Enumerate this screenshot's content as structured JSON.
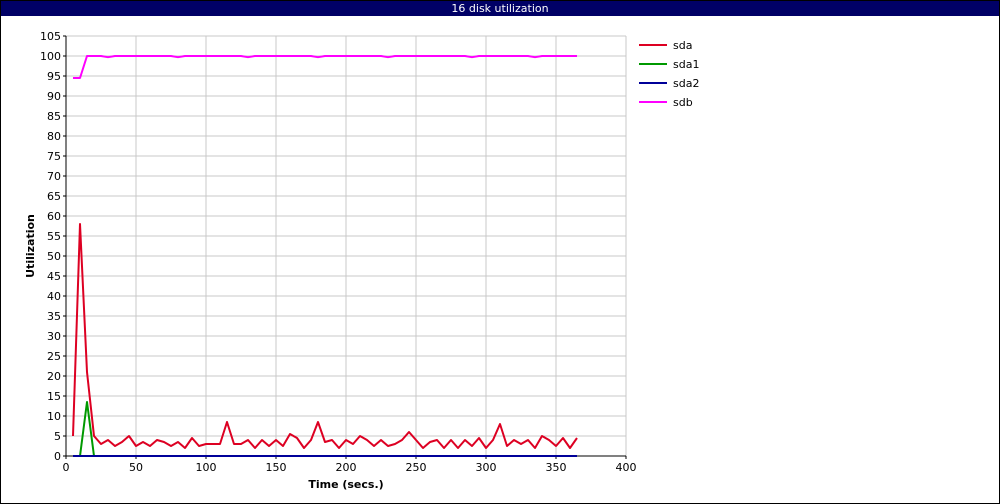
{
  "chart_data": {
    "type": "line",
    "title": "16 disk utilization",
    "xlabel": "Time (secs.)",
    "ylabel": "Utilization",
    "xlim": [
      0,
      400
    ],
    "ylim": [
      0,
      105
    ],
    "x_ticks": [
      0,
      50,
      100,
      150,
      200,
      250,
      300,
      350,
      400
    ],
    "y_ticks": [
      0,
      5,
      10,
      15,
      20,
      25,
      30,
      35,
      40,
      45,
      50,
      55,
      60,
      65,
      70,
      75,
      80,
      85,
      90,
      95,
      100,
      105
    ],
    "grid": true,
    "legend_position": "right",
    "series": [
      {
        "name": "sda",
        "color": "#dd0022",
        "x": [
          5,
          10,
          15,
          20,
          25,
          30,
          35,
          40,
          45,
          50,
          55,
          60,
          65,
          70,
          75,
          80,
          85,
          90,
          95,
          100,
          105,
          110,
          115,
          120,
          125,
          130,
          135,
          140,
          145,
          150,
          155,
          160,
          165,
          170,
          175,
          180,
          185,
          190,
          195,
          200,
          205,
          210,
          215,
          220,
          225,
          230,
          235,
          240,
          245,
          250,
          255,
          260,
          265,
          270,
          275,
          280,
          285,
          290,
          295,
          300,
          305,
          310,
          315,
          320,
          325,
          330,
          335,
          340,
          345,
          350,
          355,
          360,
          365
        ],
        "y": [
          5,
          58,
          21,
          5,
          3,
          4,
          2.5,
          3.5,
          5,
          2.5,
          3.5,
          2.5,
          4,
          3.5,
          2.5,
          3.5,
          2,
          4.5,
          2.5,
          3,
          3,
          3,
          8.5,
          3,
          3,
          4,
          2,
          4,
          2.5,
          4,
          2.5,
          5.5,
          4.5,
          2,
          4,
          8.5,
          3.5,
          4,
          2,
          4,
          3,
          5,
          4,
          2.5,
          4,
          2.5,
          3,
          4,
          6,
          4,
          2,
          3.5,
          4,
          2,
          4,
          2,
          4,
          2.5,
          4.5,
          2,
          4,
          8,
          2.5,
          4,
          3,
          4,
          2,
          5,
          4,
          2.5,
          4.5,
          2,
          4.5
        ]
      },
      {
        "name": "sda1",
        "color": "#009900",
        "x": [
          5,
          10,
          15,
          20,
          25,
          30,
          35,
          40,
          45,
          50,
          55,
          60,
          65,
          70,
          75,
          80,
          85,
          90,
          95,
          100,
          105,
          110,
          115,
          120,
          125,
          130,
          135,
          140,
          145,
          150,
          155,
          160,
          165,
          170,
          175,
          180,
          185,
          190,
          195,
          200,
          205,
          210,
          215,
          220,
          225,
          230,
          235,
          240,
          245,
          250,
          255,
          260,
          265,
          270,
          275,
          280,
          285,
          290,
          295,
          300,
          305,
          310,
          315,
          320,
          325,
          330,
          335,
          340,
          345,
          350,
          355,
          360,
          365
        ],
        "y": [
          0,
          0,
          13.5,
          0,
          0,
          0,
          0,
          0,
          0,
          0,
          0,
          0,
          0,
          0,
          0,
          0,
          0,
          0,
          0,
          0,
          0,
          0,
          0,
          0,
          0,
          0,
          0,
          0,
          0,
          0,
          0,
          0,
          0,
          0,
          0,
          0,
          0,
          0,
          0,
          0,
          0,
          0,
          0,
          0,
          0,
          0,
          0,
          0,
          0,
          0,
          0,
          0,
          0,
          0,
          0,
          0,
          0,
          0,
          0,
          0,
          0,
          0,
          0,
          0,
          0,
          0,
          0,
          0,
          0,
          0,
          0,
          0,
          0
        ]
      },
      {
        "name": "sda2",
        "color": "#000099",
        "x": [
          5,
          365
        ],
        "y": [
          0,
          0
        ]
      },
      {
        "name": "sdb",
        "color": "#ff00ff",
        "x": [
          5,
          10,
          15,
          20,
          25,
          30,
          35,
          40,
          45,
          50,
          55,
          60,
          65,
          70,
          75,
          80,
          85,
          90,
          95,
          100,
          105,
          110,
          115,
          120,
          125,
          130,
          135,
          140,
          145,
          150,
          155,
          160,
          165,
          170,
          175,
          180,
          185,
          190,
          195,
          200,
          205,
          210,
          215,
          220,
          225,
          230,
          235,
          240,
          245,
          250,
          255,
          260,
          265,
          270,
          275,
          280,
          285,
          290,
          295,
          300,
          305,
          310,
          315,
          320,
          325,
          330,
          335,
          340,
          345,
          350,
          355,
          360,
          365
        ],
        "y": [
          94.5,
          94.5,
          100,
          100,
          100,
          99.7,
          100,
          100,
          100,
          100,
          100,
          100,
          100,
          100,
          100,
          99.7,
          100,
          100,
          100,
          100,
          100,
          100,
          100,
          100,
          100,
          99.7,
          100,
          100,
          100,
          100,
          100,
          100,
          100,
          100,
          100,
          99.7,
          100,
          100,
          100,
          100,
          100,
          100,
          100,
          100,
          100,
          99.7,
          100,
          100,
          100,
          100,
          100,
          100,
          100,
          100,
          100,
          100,
          100,
          99.7,
          100,
          100,
          100,
          100,
          100,
          100,
          100,
          100,
          99.7,
          100,
          100,
          100,
          100,
          100,
          100
        ]
      }
    ]
  }
}
